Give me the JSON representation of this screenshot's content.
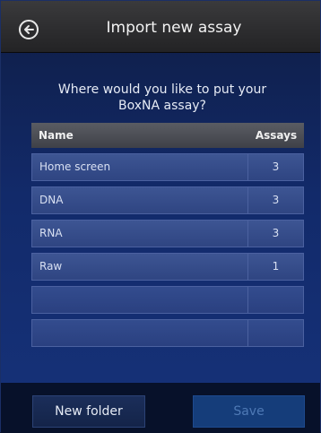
{
  "header": {
    "title": "Import new assay",
    "back_icon": "back-arrow-circle-icon"
  },
  "prompt": {
    "line1": "Where would you like to put your",
    "line2": "BoxNA assay?"
  },
  "table": {
    "columns": [
      "Name",
      "Assays"
    ],
    "rows": [
      {
        "name": "Home screen",
        "assays": "3"
      },
      {
        "name": "DNA",
        "assays": "3"
      },
      {
        "name": "RNA",
        "assays": "3"
      },
      {
        "name": "Raw",
        "assays": "1"
      },
      {
        "name": "",
        "assays": ""
      },
      {
        "name": "",
        "assays": ""
      }
    ]
  },
  "footer": {
    "new_folder_label": "New folder",
    "save_label": "Save"
  }
}
